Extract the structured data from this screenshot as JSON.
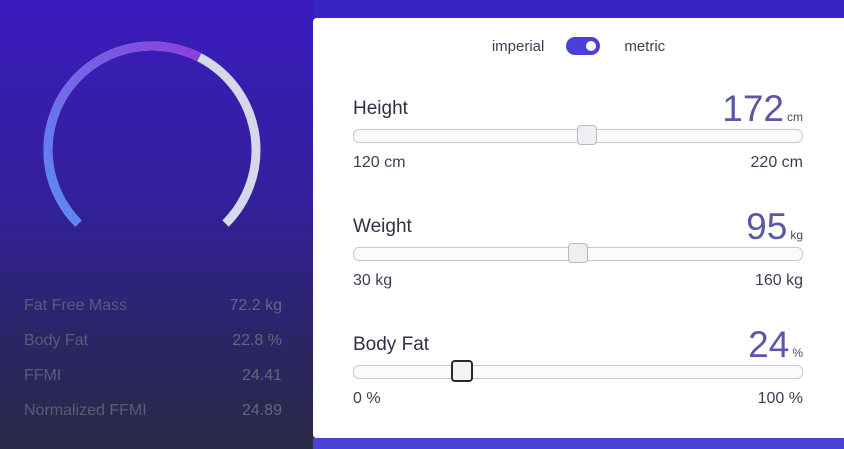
{
  "unit_toggle": {
    "imperial_label": "imperial",
    "metric_label": "metric",
    "selected": "metric"
  },
  "gauge": {
    "arc_colors": [
      "#5b8cf5",
      "#8b3fd9"
    ],
    "track_color": "#d5d8ea",
    "fill_fraction": 0.6
  },
  "stats": [
    {
      "label": "Fat Free Mass",
      "value": "72.2 kg"
    },
    {
      "label": "Body Fat",
      "value": "22.8 %"
    },
    {
      "label": "FFMI",
      "value": "24.41"
    },
    {
      "label": "Normalized FFMI",
      "value": "24.89"
    }
  ],
  "height": {
    "title": "Height",
    "value": "172",
    "unit": "cm",
    "min_label": "120 cm",
    "max_label": "220 cm",
    "min": 120,
    "max": 220,
    "current": 172
  },
  "weight": {
    "title": "Weight",
    "value": "95",
    "unit": "kg",
    "min_label": "30 kg",
    "max_label": "160 kg",
    "min": 30,
    "max": 160,
    "current": 95
  },
  "body_fat": {
    "title": "Body Fat",
    "value": "24",
    "unit": "%",
    "min_label": "0 %",
    "max_label": "100 %",
    "min": 0,
    "max": 100,
    "current": 24
  }
}
